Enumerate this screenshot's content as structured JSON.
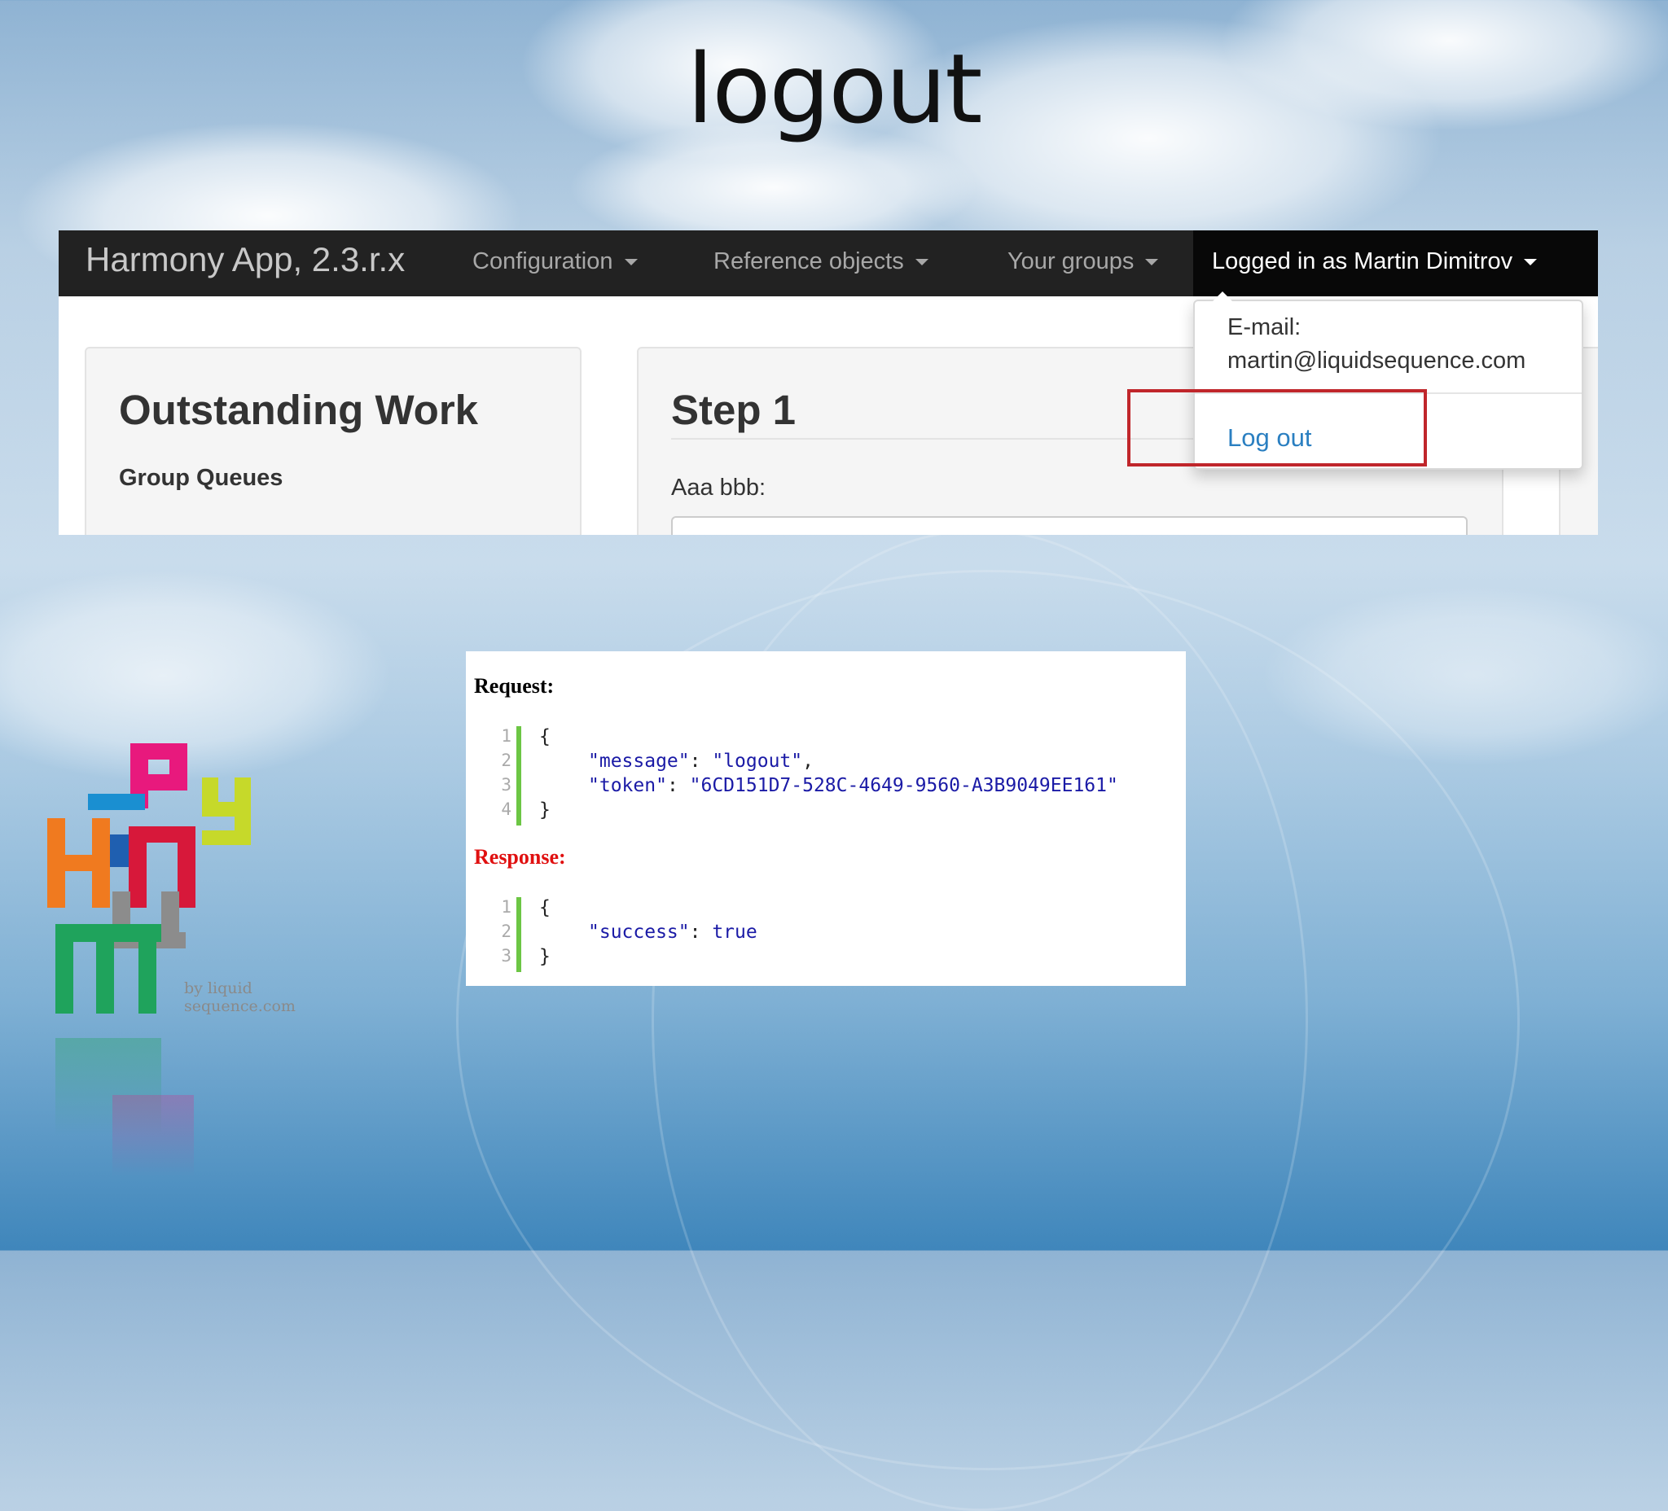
{
  "slide": {
    "title": "logout"
  },
  "app": {
    "brand": "Harmony App, 2.3.r.x",
    "nav": [
      {
        "label": "Configuration"
      },
      {
        "label": "Reference objects"
      },
      {
        "label": "Your groups"
      }
    ],
    "user_menu": {
      "label": "Logged in as Martin Dimitrov",
      "email_label": "E-mail:",
      "email": "martin@liquidsequence.com",
      "logout": "Log out"
    },
    "left_panel": {
      "title": "Outstanding Work",
      "subtitle": "Group Queues"
    },
    "step_panel": {
      "title": "Step 1",
      "field_label": "Aaa bbb:"
    }
  },
  "api": {
    "request_label": "Request:",
    "response_label": "Response:",
    "request_lines": [
      {
        "n": "1",
        "text": "{"
      },
      {
        "n": "2",
        "key": "\"message\"",
        "value": "\"logout\"",
        "trail": ","
      },
      {
        "n": "3",
        "key": "\"token\"",
        "value": "\"6CD151D7-528C-4649-9560-A3B9049EE161\"",
        "trail": ""
      },
      {
        "n": "4",
        "text": "}"
      }
    ],
    "response_lines": [
      {
        "n": "1",
        "text": "{"
      },
      {
        "n": "2",
        "key": "\"success\"",
        "value": "true",
        "trail": ""
      },
      {
        "n": "3",
        "text": "}"
      }
    ],
    "colors": {
      "request_label": "#000000",
      "response_label": "#e01010",
      "gutter": "#6cc644"
    }
  },
  "logo": {
    "tagline_line1": "by liquid",
    "tagline_line2": "sequence.com"
  }
}
